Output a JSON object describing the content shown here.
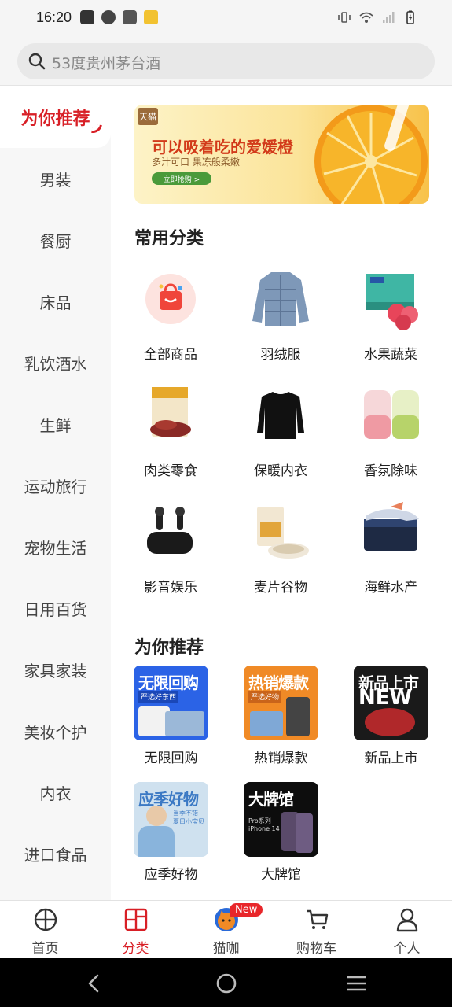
{
  "status_bar": {
    "time": "16:20"
  },
  "search": {
    "placeholder": "53度贵州茅台酒"
  },
  "sidebar": {
    "items": [
      {
        "label": "为你推荐",
        "active": true
      },
      {
        "label": "男装"
      },
      {
        "label": "餐厨"
      },
      {
        "label": "床品"
      },
      {
        "label": "乳饮酒水"
      },
      {
        "label": "生鲜"
      },
      {
        "label": "运动旅行"
      },
      {
        "label": "宠物生活"
      },
      {
        "label": "日用百货"
      },
      {
        "label": "家具家装"
      },
      {
        "label": "美妆个护"
      },
      {
        "label": "内衣"
      },
      {
        "label": "进口食品"
      }
    ]
  },
  "banner": {
    "title": "可以吸着吃的爱媛橙",
    "subtitle": "多汁可口 果冻般柔嫩",
    "button": "立即抢购 >",
    "logo": "天猫"
  },
  "common_categories": {
    "title": "常用分类",
    "items": [
      {
        "label": "全部商品",
        "icon": "shopping-bag-icon"
      },
      {
        "label": "羽绒服",
        "icon": "down-jacket"
      },
      {
        "label": "水果蔬菜",
        "icon": "fruit-box"
      },
      {
        "label": "肉类零食",
        "icon": "jerky-snack"
      },
      {
        "label": "保暖内衣",
        "icon": "thermal-shirt"
      },
      {
        "label": "香氛除味",
        "icon": "fragrance-jars"
      },
      {
        "label": "影音娱乐",
        "icon": "earbuds"
      },
      {
        "label": "麦片谷物",
        "icon": "cereal"
      },
      {
        "label": "海鲜水产",
        "icon": "seafood"
      }
    ]
  },
  "recommend": {
    "title": "为你推荐",
    "items": [
      {
        "label": "无限回购",
        "headline": "无限回购",
        "tag": "严选好东西"
      },
      {
        "label": "热销爆款",
        "headline": "热销爆款",
        "tag": "严选好物"
      },
      {
        "label": "新品上市",
        "headline": "新品上市",
        "tag": "NEW"
      },
      {
        "label": "应季好物",
        "headline": "应季好物",
        "tag": "当季不错 夏日小宝贝"
      },
      {
        "label": "大牌馆",
        "headline": "大牌馆",
        "tag": "Pro系列 iPhone 14"
      }
    ]
  },
  "tabbar": {
    "items": [
      {
        "label": "首页",
        "icon": "home-icon"
      },
      {
        "label": "分类",
        "icon": "category-icon",
        "active": true
      },
      {
        "label": "猫咖",
        "icon": "cat-cafe-icon",
        "badge": "New"
      },
      {
        "label": "购物车",
        "icon": "cart-icon"
      },
      {
        "label": "个人",
        "icon": "profile-icon"
      }
    ]
  }
}
